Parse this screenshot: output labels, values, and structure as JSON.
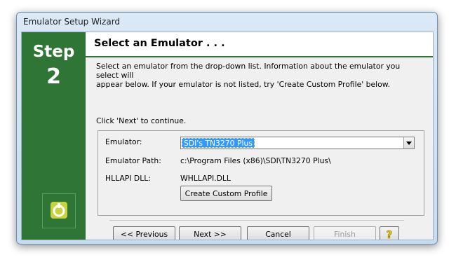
{
  "window": {
    "title": "Emulator Setup Wizard"
  },
  "step": {
    "label": "Step",
    "number": "2"
  },
  "header": {
    "title": "Select an Emulator . . ."
  },
  "description": {
    "line1": "Select an emulator from the drop-down list.  Information about the emulator you select will",
    "line2": "appear below. If your emulator is not listed, try 'Create Custom Profile' below."
  },
  "continue_text": "Click 'Next' to continue.",
  "form": {
    "emulator_label": "Emulator:",
    "emulator_value": "SDI's TN3270 Plus",
    "path_label": "Emulator Path:",
    "path_value": "c:\\Program Files (x86)\\SDI\\TN3270 Plus\\",
    "dll_label": "HLLAPI DLL:",
    "dll_value": "WHLLAPI.DLL",
    "custom_profile_button": "Create Custom Profile"
  },
  "buttons": {
    "previous": "<< Previous",
    "next": "Next >>",
    "cancel": "Cancel",
    "finish": "Finish",
    "help_icon": "help-icon"
  },
  "colors": {
    "accent_green": "#2f7535",
    "selection_blue": "#3399ff",
    "help_yellow": "#e8c800"
  }
}
